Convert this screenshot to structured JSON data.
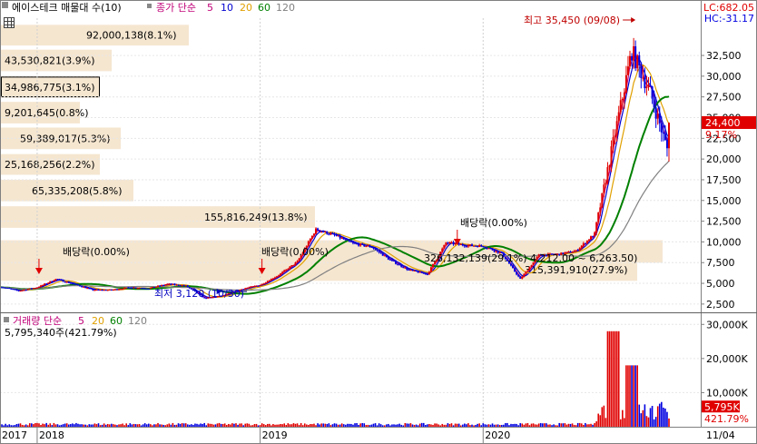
{
  "header": {
    "title": "에이스테크 매물대 수(10)",
    "price_legend_label": "종가 단순",
    "periods": [
      "5",
      "10",
      "20",
      "60",
      "120"
    ],
    "lc": "LC:682.05",
    "hc": "HC:-31.17"
  },
  "volume_header": {
    "label": "거래량 단순",
    "periods": [
      "5",
      "20",
      "60",
      "120"
    ],
    "summary": "5,795,340주(421.79%)"
  },
  "colors": {
    "ma5": "#c00078",
    "ma10": "#0000d0",
    "ma20": "#e0a000",
    "ma60": "#008000",
    "ma120": "#808080",
    "candle_up": "#e00000",
    "candle_down": "#0000e0",
    "volume_profile": "#f5e6d0",
    "current_price_bg": "#e00000"
  },
  "annotations": {
    "high": "최고 35,450 (09/08)",
    "low": "최저 3,120 (10/30)",
    "dividends": [
      "배당락(0.00%)",
      "배당락(0.00%)",
      "배당락(0.00%)"
    ],
    "range_text": "326,132,139(29.1%) 4,212.00 ~ 6,263.50)"
  },
  "chart_data": {
    "type": "candlestick",
    "price_axis": {
      "ylim": [
        1500,
        37000
      ],
      "ticks": [
        "32,500",
        "30,000",
        "27,500",
        "25,000",
        "22,500",
        "20,000",
        "17,500",
        "15,000",
        "12,500",
        "10,000",
        "7,500",
        "5,000",
        "2,500"
      ],
      "tick_values": [
        32500,
        30000,
        27500,
        25000,
        22500,
        20000,
        17500,
        15000,
        12500,
        10000,
        7500,
        5000,
        2500
      ]
    },
    "current_price": "24,400",
    "current_change": "9.17%",
    "x_axis": {
      "labels": [
        "2017",
        "2018",
        "2019",
        "2020",
        "11/04"
      ],
      "label_dates": [
        "2017-11",
        "2018-01",
        "2019-01",
        "2020-01",
        "2020-11-04"
      ]
    },
    "price_keyframes": {
      "x": [
        "2017-11",
        "2017-12",
        "2018-01",
        "2018-02",
        "2018-03",
        "2018-04",
        "2018-05",
        "2018-06",
        "2018-07",
        "2018-08",
        "2018-09",
        "2018-10",
        "2018-11",
        "2018-12",
        "2019-01",
        "2019-02",
        "2019-03",
        "2019-04",
        "2019-05",
        "2019-06",
        "2019-07",
        "2019-08",
        "2019-09",
        "2019-10",
        "2019-11",
        "2019-12",
        "2020-01",
        "2020-02",
        "2020-03",
        "2020-04",
        "2020-05",
        "2020-06",
        "2020-07",
        "2020-08",
        "2020-09",
        "2020-10",
        "2020-11"
      ],
      "close": [
        4600,
        4100,
        4500,
        5500,
        4900,
        4200,
        4200,
        4500,
        4400,
        4900,
        4700,
        3200,
        3500,
        4300,
        4800,
        6000,
        7600,
        11500,
        10800,
        9800,
        9400,
        7800,
        6600,
        6100,
        9900,
        9600,
        9500,
        8600,
        5500,
        8400,
        8500,
        8900,
        11000,
        22000,
        33000,
        28000,
        20500
      ]
    },
    "moving_averages": [
      {
        "name": "5",
        "color": "#c00078"
      },
      {
        "name": "10",
        "color": "#0000d0"
      },
      {
        "name": "20",
        "color": "#e0a000"
      },
      {
        "name": "60",
        "color": "#008000"
      },
      {
        "name": "120",
        "color": "#808080"
      }
    ],
    "volume_profile": [
      {
        "label": "92,000,138(8.1%)",
        "price_low": 33700,
        "price_high": 36200
      },
      {
        "label": "43,530,821(3.9%)",
        "price_low": 30600,
        "price_high": 33200
      },
      {
        "label": "34,986,775(3.1%)",
        "price_low": 27400,
        "price_high": 30000
      },
      {
        "label": "9,201,645(0.8%)",
        "price_low": 24300,
        "price_high": 26900
      },
      {
        "label": "59,389,017(5.3%)",
        "price_low": 21200,
        "price_high": 23800
      },
      {
        "label": "25,168,256(2.2%)",
        "price_low": 18100,
        "price_high": 20600
      },
      {
        "label": "65,335,208(5.8%)",
        "price_low": 14900,
        "price_high": 17500
      },
      {
        "label": "155,816,249(13.8%)",
        "price_low": 11700,
        "price_high": 14300
      },
      {
        "label": "",
        "price_low": 7500,
        "price_high": 10200
      },
      {
        "label": "315,391,910(27.9%)",
        "price_low": 5300,
        "price_high": 8000
      }
    ],
    "volume_axis": {
      "ylim": [
        0,
        33000000
      ],
      "ticks": [
        "30,000K",
        "20,000K",
        "10,000K"
      ],
      "tick_values": [
        30000000,
        20000000,
        10000000
      ]
    },
    "volume_current": "5,795K",
    "volume_current_pct": "421.79%"
  }
}
